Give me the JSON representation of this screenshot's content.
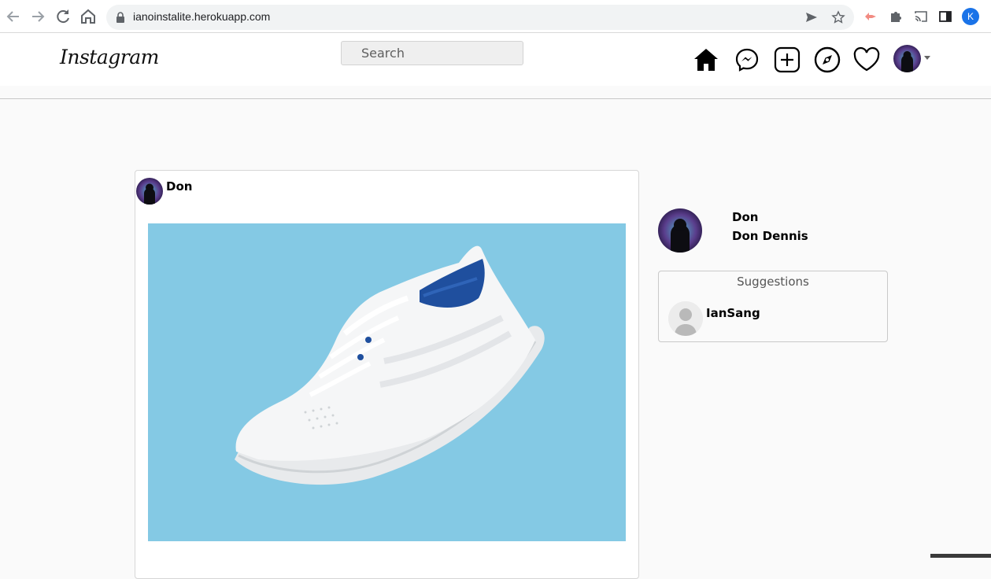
{
  "browser": {
    "url": "ianoinstalite.herokuapp.com",
    "profile_initial": "K"
  },
  "nav": {
    "logo": "Instagram",
    "search_placeholder": "Search"
  },
  "post": {
    "username": "Don",
    "image_description": "white sneaker on light blue background"
  },
  "sidebar": {
    "username": "Don",
    "full_name": "Don Dennis",
    "suggestions_title": "Suggestions",
    "suggestions": [
      {
        "username": "IanSang"
      }
    ]
  },
  "colors": {
    "page_bg": "#fafafa",
    "image_bg": "#84c9e4",
    "chrome_accent": "#1a73e8"
  }
}
